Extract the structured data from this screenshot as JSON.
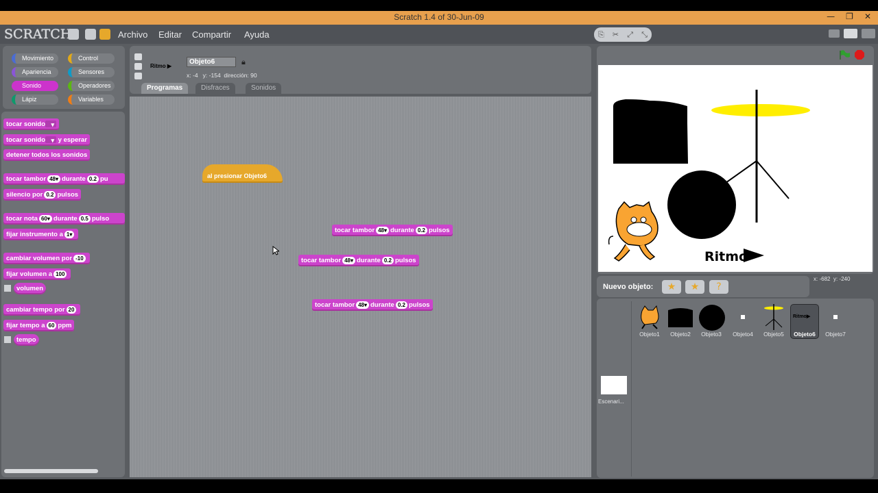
{
  "window": {
    "title": "Scratch 1.4 of 30-Jun-09",
    "minimize": "—",
    "restore": "❐",
    "close": "✕"
  },
  "menu": {
    "logo": "SCRATCH",
    "items": [
      "Archivo",
      "Editar",
      "Compartir",
      "Ayuda"
    ]
  },
  "categories": [
    {
      "label": "Movimiento",
      "color": "#4a6cd4"
    },
    {
      "label": "Control",
      "color": "#e1a91a"
    },
    {
      "label": "Apariencia",
      "color": "#8a55d7"
    },
    {
      "label": "Sensores",
      "color": "#0e9bc8"
    },
    {
      "label": "Sonido",
      "color": "#cc33cc"
    },
    {
      "label": "Operadores",
      "color": "#5cb712"
    },
    {
      "label": "Lápiz",
      "color": "#0e9a6c"
    },
    {
      "label": "Variables",
      "color": "#ee7d16"
    }
  ],
  "palette": {
    "b1": "tocar sonido",
    "b2a": "tocar sonido",
    "b2b": "y esperar",
    "b3": "detener todos los sonidos",
    "b4a": "tocar tambor",
    "b4n": "48",
    "b4b": "durante",
    "b4v": "0.2",
    "b4c": "pu",
    "b5a": "silencio por",
    "b5v": "0.2",
    "b5b": "pulsos",
    "b6a": "tocar nota",
    "b6n": "60",
    "b6b": "durante",
    "b6v": "0.5",
    "b6c": "pulso",
    "b7a": "fijar instrumento a",
    "b7n": "1",
    "b8a": "cambiar volumen por",
    "b8v": "-10",
    "b9a": "fijar volumen a",
    "b9v": "100",
    "b10": "volumen",
    "b11a": "cambiar tempo por",
    "b11v": "20",
    "b12a": "fijar tempo a",
    "b12v": "60",
    "b12b": "ppm",
    "b13": "tempo"
  },
  "sprite": {
    "thumb_label": "Ritmo",
    "name": "Objeto6",
    "x_label": "x:",
    "x": "-4",
    "y_label": "y:",
    "y": "-154",
    "dir_label": "dirección:",
    "dir": "90"
  },
  "tabs": [
    "Programas",
    "Disfraces",
    "Sonidos"
  ],
  "scripts": {
    "hat": "al presionar Objeto6",
    "s1a": "tocar tambor",
    "s1n": "48",
    "s1b": "durante",
    "s1v": "0.2",
    "s1c": "pulsos",
    "s2a": "tocar tambor",
    "s2n": "48",
    "s2b": "durante",
    "s2v": "0.2",
    "s2c": "pulsos",
    "s3a": "tocar tambor",
    "s3n": "48",
    "s3b": "durante",
    "s3v": "0.2",
    "s3c": "pulsos"
  },
  "stage": {
    "text": "Ritmo",
    "coords_x_label": "x:",
    "coords_x": "-682",
    "coords_y_label": "y:",
    "coords_y": "-240"
  },
  "sprites_panel": {
    "new_label": "Nuevo objeto:",
    "sprites": [
      "Objeto1",
      "Objeto2",
      "Objeto3",
      "Objeto4",
      "Objeto5",
      "Objeto6",
      "Objeto7"
    ],
    "stage_label": "Escenari..."
  }
}
